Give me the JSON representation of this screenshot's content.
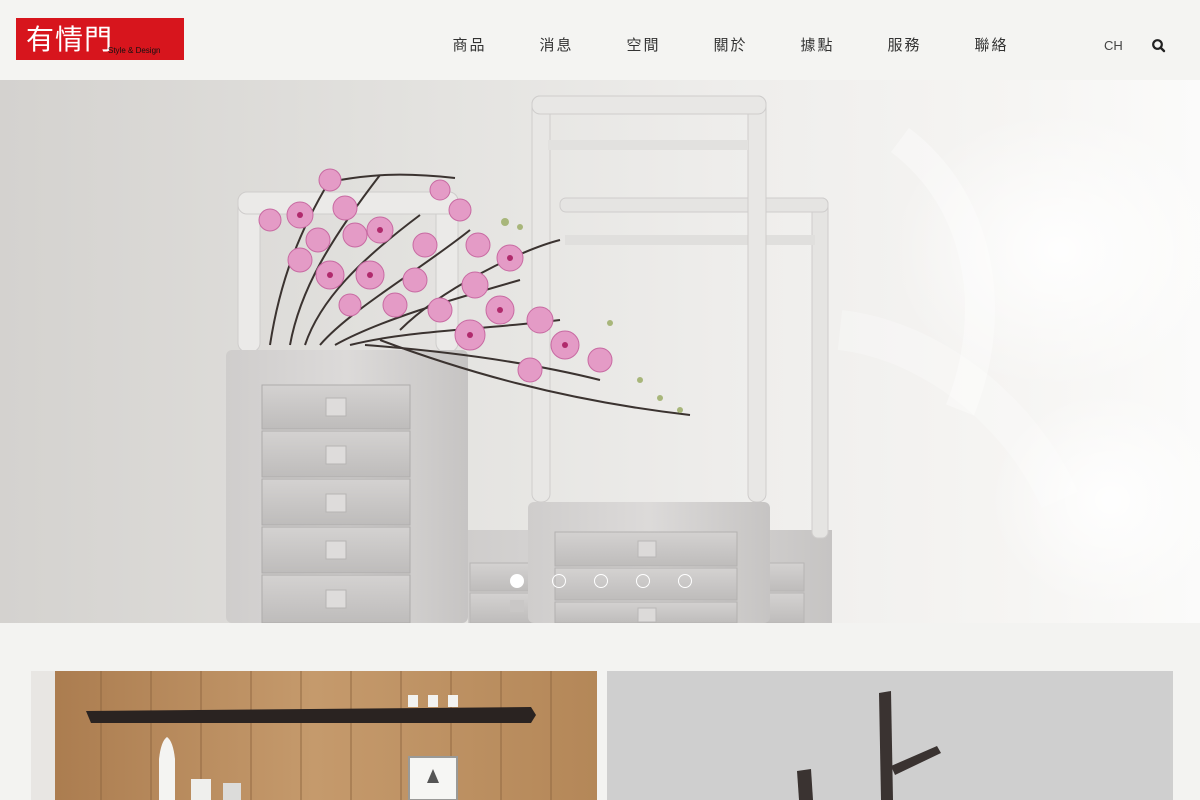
{
  "brand": {
    "logo_main": "有情門",
    "logo_sub": "Style & Design",
    "accent_color": "#d7151d"
  },
  "nav": {
    "items": [
      {
        "label": "商品"
      },
      {
        "label": "消息"
      },
      {
        "label": "空間"
      },
      {
        "label": "關於"
      },
      {
        "label": "據點"
      },
      {
        "label": "服務"
      },
      {
        "label": "聯絡"
      }
    ],
    "language": "CH",
    "search_icon": "search-icon"
  },
  "hero": {
    "slide_count": 5,
    "active_slide": 1,
    "image": "white-drawer-cabinets-with-pink-orchids"
  },
  "tiles": [
    {
      "image": "wooden-wall-with-dark-shelf-and-vases"
    },
    {
      "image": "dark-wood-coat-rack-on-grey"
    }
  ]
}
